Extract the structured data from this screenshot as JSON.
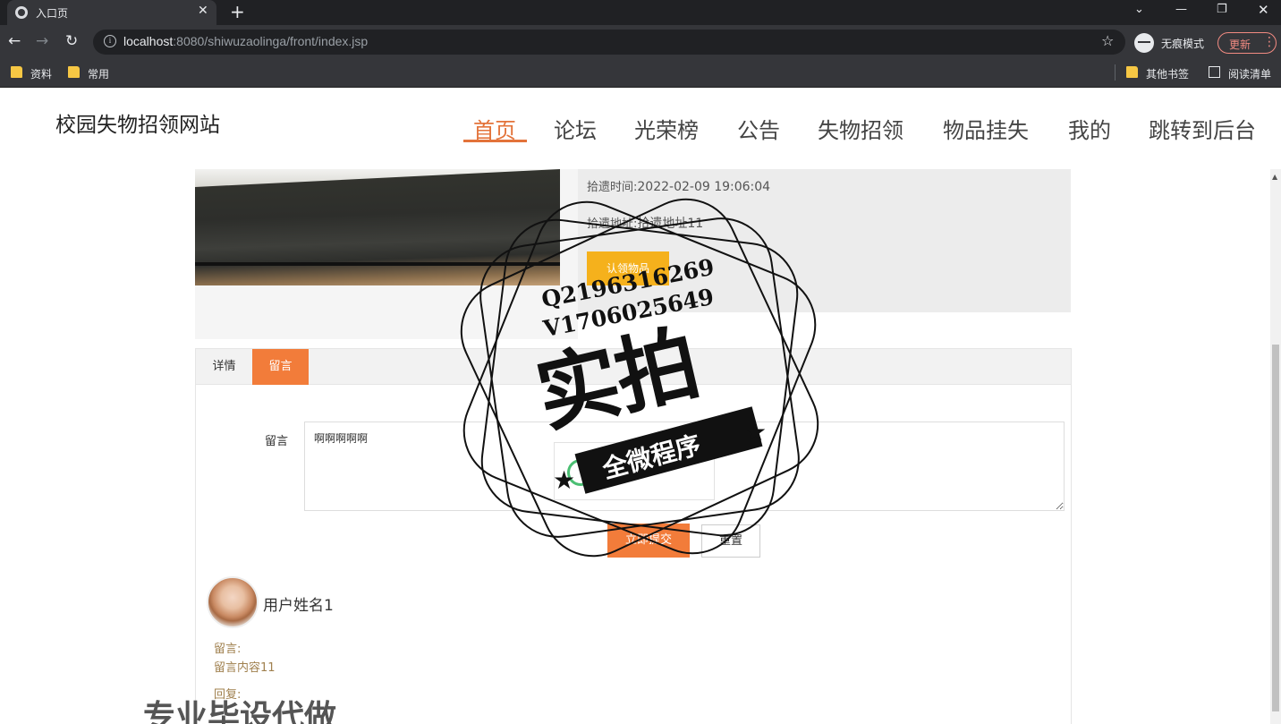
{
  "browser": {
    "tab_title": "入口页",
    "url_host": "localhost",
    "url_rest": ":8080/shiwuzaolinga/front/index.jsp",
    "incognito_label": "无痕模式",
    "update_label": "更新",
    "bookmarks_left": [
      "资料",
      "常用"
    ],
    "bookmarks_right": [
      "其他书签",
      "阅读清单"
    ]
  },
  "site": {
    "logo": "校园失物招领网站",
    "nav": [
      "首页",
      "论坛",
      "光荣榜",
      "公告",
      "失物招领",
      "物品挂失",
      "我的",
      "跳转到后台"
    ],
    "active_nav": "首页",
    "accent_color": "#e3733a"
  },
  "detail": {
    "time_label": "拾遗时间:",
    "time_value": "2022-02-09 19:06:04",
    "place_label": "拾遗地址:",
    "place_value": "拾遗地址11",
    "claim_button": "认领物品"
  },
  "tabs": [
    "详情",
    "留言"
  ],
  "active_tab": "留言",
  "message_form": {
    "label": "留言",
    "value": "啊啊啊啊啊",
    "submit_label": "立即提交",
    "reset_label": "重置"
  },
  "comment": {
    "user_name": "用户姓名1",
    "message_label": "留言:",
    "message_text": "留言内容11",
    "reply_label": "回复:"
  },
  "watermark": {
    "qq": "Q2196316269",
    "v": "V1706025649",
    "main": "实拍",
    "ribbon": "全微程序",
    "bottom": "专业毕设代做"
  }
}
